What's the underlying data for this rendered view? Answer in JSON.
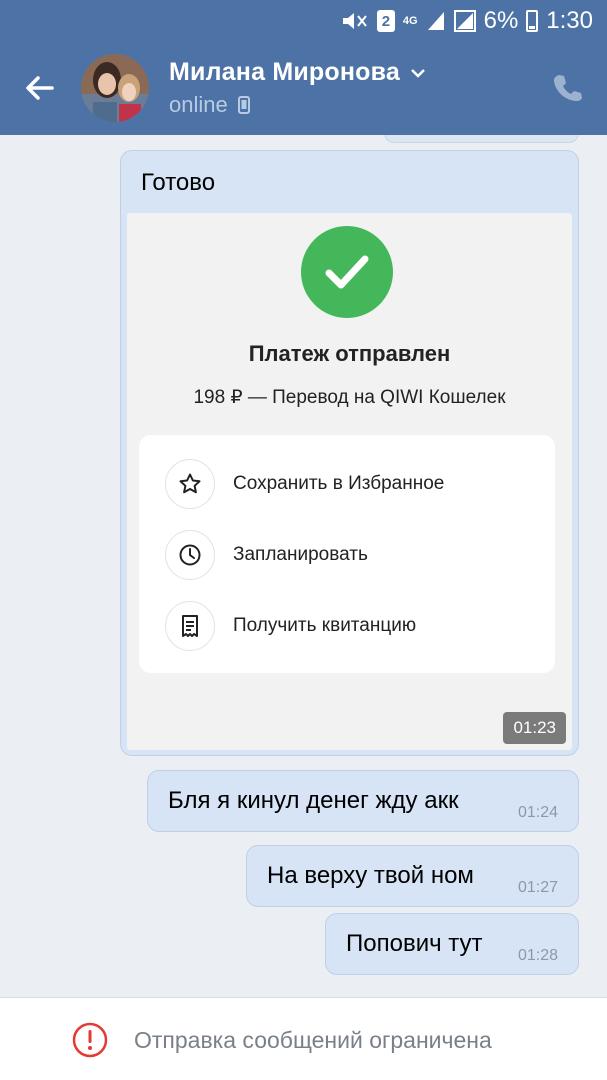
{
  "status_bar": {
    "battery": "6%",
    "time": "1:30",
    "sim": "2",
    "network": "4G"
  },
  "header": {
    "contact_name": "Милана Миронова",
    "presence": "online",
    "icons": [
      "back-arrow-icon",
      "avatar",
      "chevron-down-icon",
      "mobile-icon",
      "phone-icon"
    ]
  },
  "messages": [
    {
      "text": "Готово",
      "time": "01:23",
      "attachment": {
        "title": "Платеж отправлен",
        "subtitle": "198 ₽ — Перевод на QIWI Кошелек",
        "actions": [
          {
            "label": "Сохранить в Избранное",
            "icon": "star-icon"
          },
          {
            "label": "Запланировать",
            "icon": "clock-icon"
          },
          {
            "label": "Получить квитанцию",
            "icon": "receipt-icon"
          }
        ]
      }
    },
    {
      "text": "Бля я кинул денег жду акк",
      "time": "01:24"
    },
    {
      "text": "На верху твой ном",
      "time": "01:27"
    },
    {
      "text": "Попович тут",
      "time": "01:28"
    }
  ],
  "footer": {
    "notice": "Отправка сообщений ограничена",
    "icon": "exclamation-circle-icon"
  },
  "colors": {
    "header": "#4d73a6",
    "bubble": "#d6e4f5",
    "chat_bg": "#ebeef2",
    "success": "#44b75a",
    "warning": "#e53935"
  }
}
